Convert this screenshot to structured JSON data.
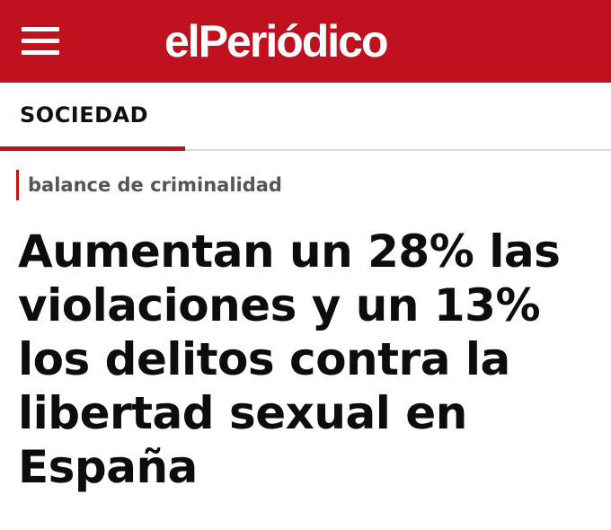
{
  "header": {
    "logo_text": "elPeriódico",
    "brand_color": "#c0111f",
    "menu_icon": "hamburger-menu-icon"
  },
  "section": {
    "label": "SOCIEDAD"
  },
  "article": {
    "kicker": "balance de criminalidad",
    "headline": "Aumentan un 28% las violaciones y un 13% los delitos contra la libertad sexual en España"
  }
}
